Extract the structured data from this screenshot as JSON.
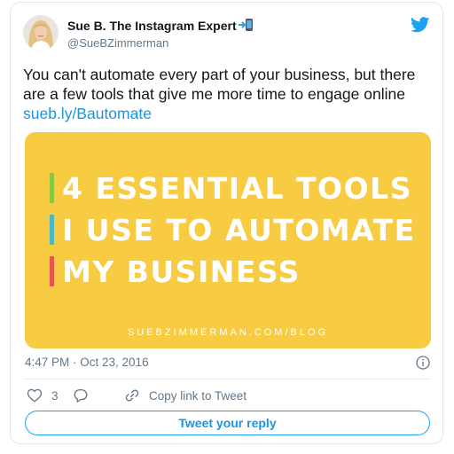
{
  "author": {
    "display_name": "Sue B. The Instagram Expert",
    "handle": "@SueBZimmerman",
    "name_emoji_icon": "mobile-phone-arrow-icon"
  },
  "brand_icon": "twitter-bird-icon",
  "tweet": {
    "text": "You can't automate every part of your business, but there are a few tools that give me more time to engage online",
    "link": "sueb.ly/Bautomate"
  },
  "media": {
    "lines": [
      "4 ESSENTIAL TOOLS",
      "I USE TO AUTOMATE",
      "MY BUSINESS"
    ],
    "footer": "SUEBZIMMERMAN.COM/BLOG",
    "background_color": "#f7cc42",
    "bar_colors": [
      "#8cc63f",
      "#4ab8c4",
      "#e8554e"
    ]
  },
  "timestamp": "4:47 PM · Oct 23, 2016",
  "actions": {
    "like_count": "3",
    "copy_link_label": "Copy link to Tweet"
  },
  "reply_button_label": "Tweet your reply",
  "colors": {
    "accent": "#1da1f2",
    "link": "#1b95e0",
    "muted": "#657786"
  }
}
